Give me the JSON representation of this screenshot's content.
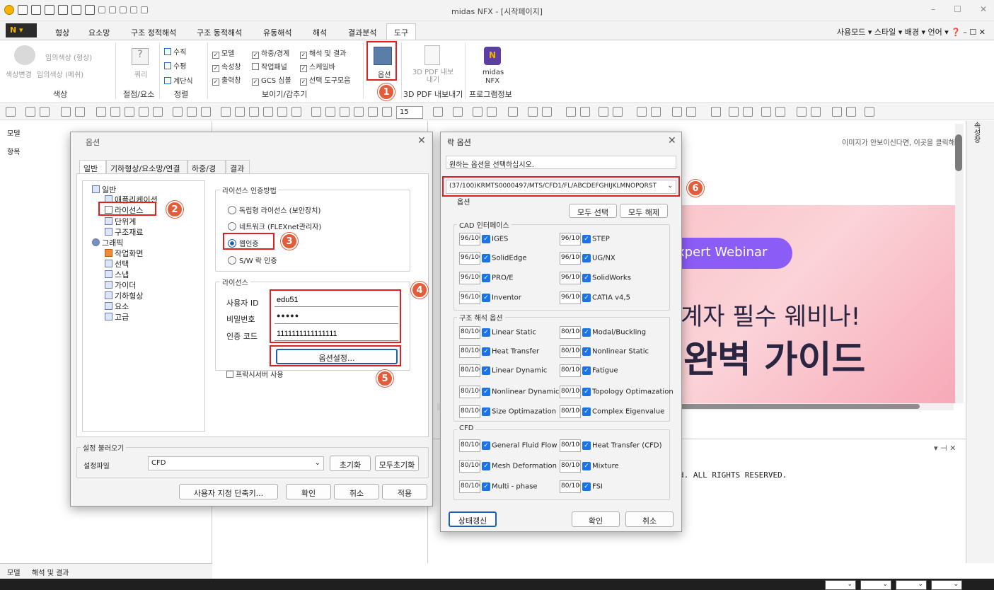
{
  "window": {
    "title": "midas NFX - [시작페이지]",
    "min": "–",
    "max": "☐",
    "close": "✕"
  },
  "menubar": {
    "app_button": "N ▾",
    "items": [
      "형상",
      "요소망",
      "구조 정적해석",
      "구조 동적해석",
      "유동해석",
      "해석",
      "결과분석",
      "도구"
    ],
    "right": "사용모드 ▾ 스타일 ▾ 배경 ▾ 언어 ▾ ❓ – ☐ ✕"
  },
  "ribbon": {
    "color_group": {
      "label": "색상",
      "btn1": "임의색상 (형상)",
      "btn2": "임의색상 (메쉬)",
      "big": "색상변경"
    },
    "snap_group": {
      "label": "절점/요소",
      "query": "쿼리"
    },
    "align_group": {
      "label": "정렬",
      "items": [
        "수직",
        "수평",
        "계단식"
      ]
    },
    "view_group": {
      "label": "보이기/감추기",
      "checks": [
        "모델",
        "하중/경계",
        "해석 및 결과",
        "속성창",
        "작업패널",
        "스케일바",
        "출력창",
        "GCS 심볼",
        "선택 도구모음"
      ]
    },
    "options_btn": "옵션",
    "pdf": {
      "label": "3D PDF 내보내기",
      "btn": "3D PDF 내보내기"
    },
    "about": {
      "label": "프로그램정보",
      "btn1": "midas",
      "btn2": "NFX"
    },
    "zoom_value": "15"
  },
  "left_panel": {
    "title": "모델",
    "item": "항목",
    "tabs": [
      "모델",
      "해석 및 결과"
    ]
  },
  "web": {
    "link_text": "이미지가 안보이신다면, 이곳을 클릭해",
    "pill": "xpert Webinar",
    "line1": "계자 필수 웨비나!",
    "line2": "완벽 가이드"
  },
  "output": {
    "text": "d. ALL RIGHTS RESERVED.",
    "controls": "▾ ⊣ ✕"
  },
  "right_strip": "속성창",
  "options_dialog": {
    "title": "옵션",
    "tabs": [
      "일반",
      "기하형상/요소망/연결",
      "하중/경계",
      "결과"
    ],
    "tree": [
      "일반",
      "애플리케이션",
      "라이선스",
      "단위계",
      "구조재료",
      "그래픽",
      "작업화면",
      "선택",
      "스냅",
      "가이더",
      "기하형상",
      "요소",
      "고급"
    ],
    "auth": {
      "legend": "라이선스 인증방법",
      "options": [
        "독립형 라이선스 (보안장치)",
        "네트워크 (FLEXnet관리자)",
        "웹인증",
        "S/W 락 인증"
      ],
      "selected": "웹인증"
    },
    "license": {
      "legend": "라이선스",
      "user_id_label": "사용자 ID",
      "user_id": "edu51",
      "password_label": "비밀번호",
      "password": "●●●●●",
      "auth_code_label": "인증 코드",
      "auth_code": "1111111111111111",
      "options_button": "옵션설정...",
      "proxy": "프락시서버 사용"
    },
    "load": {
      "legend": "설정 불러오기",
      "file_label": "설정파일",
      "file_value": "CFD",
      "reset": "초기화",
      "reset_all": "모두초기화"
    },
    "buttons": {
      "shortcut": "사용자 지정 단축키...",
      "ok": "확인",
      "cancel": "취소",
      "apply": "적용"
    }
  },
  "lock_dialog": {
    "title": "락 옵션",
    "prompt": "원하는 옵션을 선택하십시오.",
    "option_value": "(37/100)KRMTS0000497/MTS/CFD1/FL/ABCDEFGHIJKLMNOPQRST",
    "options_label": "옵션",
    "select_all": "모두 선택",
    "clear_all": "모두 해제",
    "cad": {
      "legend": "CAD 인터페이스",
      "count": "96/100",
      "items": [
        "IGES",
        "STEP",
        "SolidEdge",
        "UG/NX",
        "PRO/E",
        "SolidWorks",
        "Inventor",
        "CATIA v4,5"
      ]
    },
    "struct": {
      "legend": "구조 해석 옵션",
      "count": "80/100",
      "items": [
        "Linear Static",
        "Modal/Buckling",
        "Heat Transfer",
        "Nonlinear Static",
        "Linear Dynamic",
        "Fatigue",
        "Nonlinear Dynamic /",
        "Topology Optimazation",
        "Size Optimazation",
        "Complex Eigenvalue"
      ]
    },
    "cfd": {
      "legend": "CFD",
      "count": "80/100",
      "items": [
        "General Fluid Flow",
        "Heat Transfer (CFD)",
        "Mesh Deformation",
        "Mixture",
        "Multi - phase",
        "FSI"
      ]
    },
    "refresh": "상태갱신",
    "ok": "확인",
    "cancel": "취소"
  },
  "badges": [
    "1",
    "2",
    "3",
    "4",
    "5",
    "6"
  ],
  "accent": {
    "red": "#e02020",
    "badge": "#e35d3a",
    "check": "#1a73e8"
  }
}
